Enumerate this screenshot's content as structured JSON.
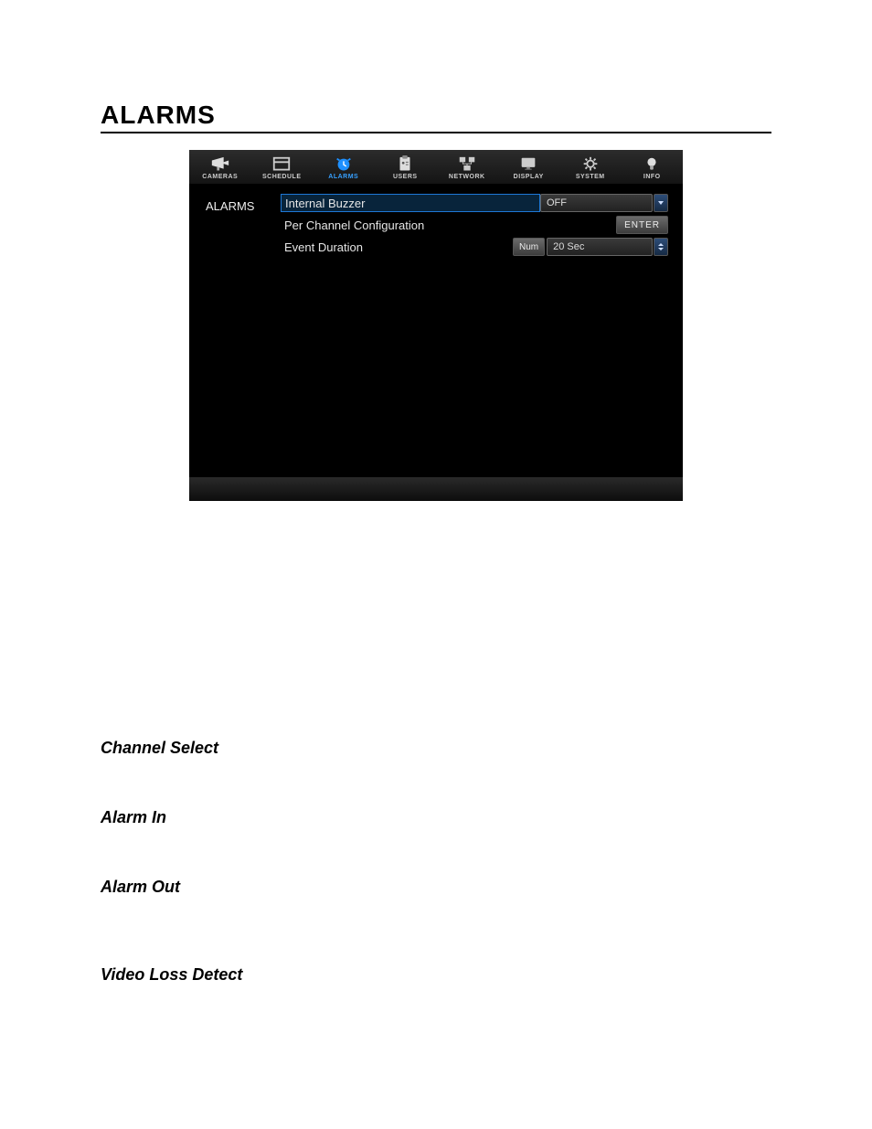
{
  "page_title": "ALARMS",
  "tabbar": [
    {
      "label": "CAMERAS",
      "active": false
    },
    {
      "label": "SCHEDULE",
      "active": false
    },
    {
      "label": "ALARMS",
      "active": true
    },
    {
      "label": "USERS",
      "active": false
    },
    {
      "label": "NETWORK",
      "active": false
    },
    {
      "label": "DISPLAY",
      "active": false
    },
    {
      "label": "SYSTEM",
      "active": false
    },
    {
      "label": "INFO",
      "active": false
    }
  ],
  "side_label": "ALARMS",
  "rows": {
    "internal_buzzer": {
      "label": "Internal Buzzer",
      "value": "OFF"
    },
    "per_channel": {
      "label": "Per Channel Configuration",
      "button": "ENTER"
    },
    "event_duration": {
      "label": "Event Duration",
      "prefix": "Num",
      "value": "20 Sec"
    }
  },
  "sections": [
    "Channel Select",
    "Alarm In",
    "Alarm Out",
    "Video Loss Detect"
  ]
}
